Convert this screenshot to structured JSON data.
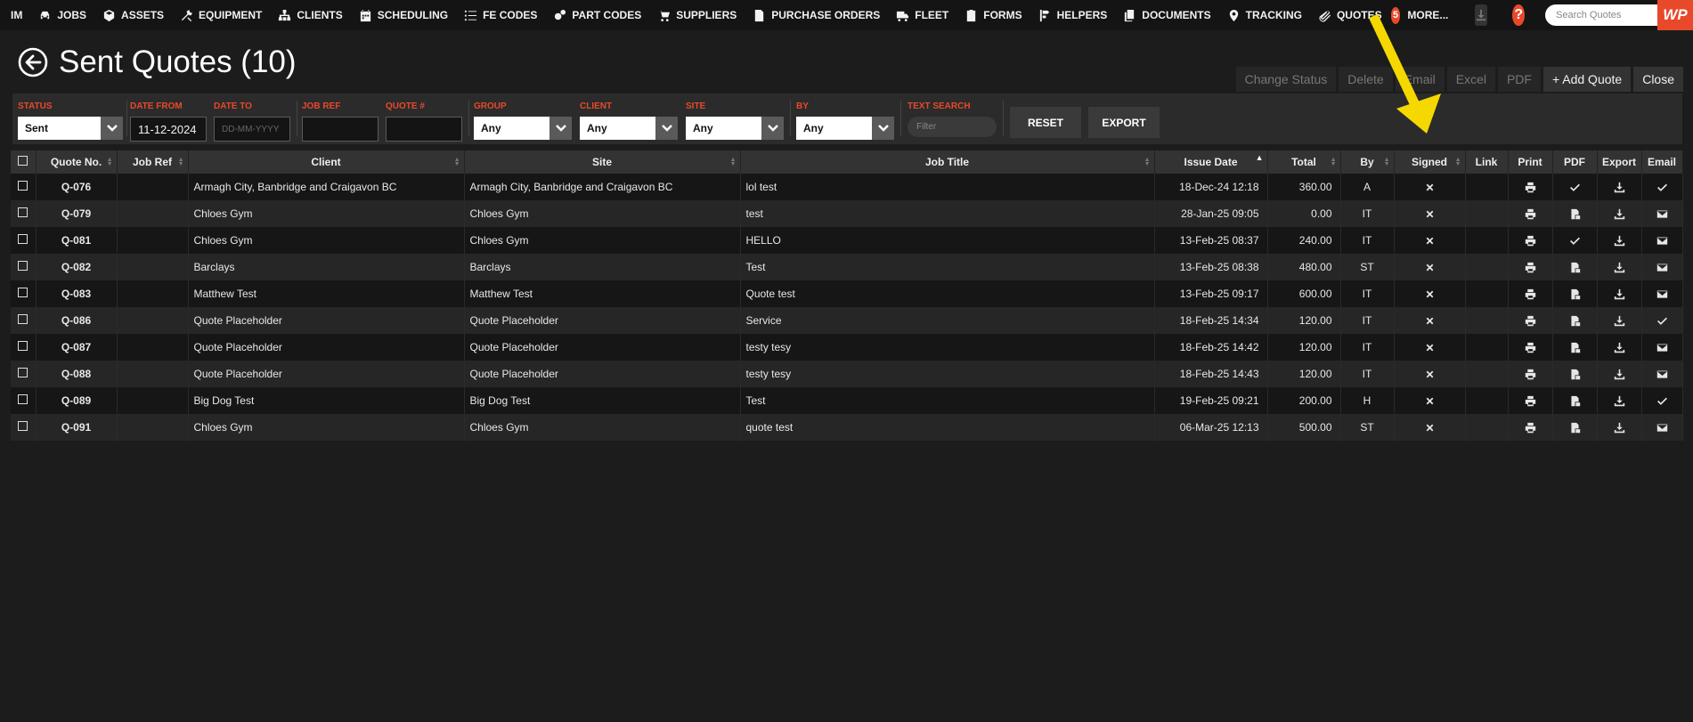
{
  "nav": {
    "items": [
      {
        "label": "IM",
        "icon": ""
      },
      {
        "label": "JOBS",
        "icon": "car-icon"
      },
      {
        "label": "ASSETS",
        "icon": "cube-icon"
      },
      {
        "label": "EQUIPMENT",
        "icon": "tools-icon"
      },
      {
        "label": "CLIENTS",
        "icon": "sitemap-icon"
      },
      {
        "label": "SCHEDULING",
        "icon": "calendar-icon"
      },
      {
        "label": "FE CODES",
        "icon": "list-icon"
      },
      {
        "label": "PART CODES",
        "icon": "gears-icon"
      },
      {
        "label": "SUPPLIERS",
        "icon": "cart-icon"
      },
      {
        "label": "PURCHASE ORDERS",
        "icon": "file-icon"
      },
      {
        "label": "FLEET",
        "icon": "truck-icon"
      },
      {
        "label": "FORMS",
        "icon": "clipboard-icon"
      },
      {
        "label": "HELPERS",
        "icon": "helpers-icon"
      },
      {
        "label": "DOCUMENTS",
        "icon": "documents-icon"
      },
      {
        "label": "TRACKING",
        "icon": "map-pin-icon"
      },
      {
        "label": "QUOTES",
        "icon": "paperclip-icon"
      }
    ],
    "badge_count": "5",
    "more_label": "MORE...",
    "help_label": "?",
    "search_placeholder": "Search Quotes",
    "logo_text": "WP"
  },
  "page": {
    "title": "Sent Quotes (10)"
  },
  "actions": [
    {
      "label": "Change Status",
      "enabled": false
    },
    {
      "label": "Delete",
      "enabled": false
    },
    {
      "label": "Email",
      "enabled": false
    },
    {
      "label": "Excel",
      "enabled": false
    },
    {
      "label": "PDF",
      "enabled": false
    },
    {
      "label": "+ Add Quote",
      "enabled": true
    },
    {
      "label": "Close",
      "enabled": true
    }
  ],
  "filters": {
    "status": {
      "label": "STATUS",
      "value": "Sent"
    },
    "date_from": {
      "label": "DATE FROM",
      "value": "11-12-2024"
    },
    "date_to": {
      "label": "DATE TO",
      "placeholder": "DD-MM-YYYY"
    },
    "job_ref": {
      "label": "JOB REF",
      "value": ""
    },
    "quote_no": {
      "label": "QUOTE #",
      "value": ""
    },
    "group": {
      "label": "GROUP",
      "value": "Any"
    },
    "client": {
      "label": "CLIENT",
      "value": "Any"
    },
    "site": {
      "label": "SITE",
      "value": "Any"
    },
    "by": {
      "label": "BY",
      "value": "Any"
    },
    "text_search": {
      "label": "TEXT SEARCH",
      "placeholder": "Filter"
    },
    "reset_label": "RESET",
    "export_label": "EXPORT"
  },
  "table": {
    "columns": [
      "Quote No.",
      "Job Ref",
      "Client",
      "Site",
      "Job Title",
      "Issue Date",
      "Total",
      "By",
      "Signed",
      "Link",
      "Print",
      "PDF",
      "Export",
      "Email"
    ],
    "rows": [
      {
        "quote_no": "Q-076",
        "job_ref": "",
        "client": "Armagh City, Banbridge and Craigavon BC",
        "site": "Armagh City, Banbridge and Craigavon BC",
        "job_title": "lol test",
        "issue_date": "18-Dec-24 12:18",
        "total": "360.00",
        "by": "A",
        "signed": "cross",
        "pdf": "check",
        "email": "check"
      },
      {
        "quote_no": "Q-079",
        "job_ref": "",
        "client": "Chloes Gym",
        "site": "Chloes Gym",
        "job_title": "test",
        "issue_date": "28-Jan-25 09:05",
        "total": "0.00",
        "by": "IT",
        "signed": "cross",
        "pdf": "pdf",
        "email": "envelope"
      },
      {
        "quote_no": "Q-081",
        "job_ref": "",
        "client": "Chloes Gym",
        "site": "Chloes Gym",
        "job_title": "HELLO",
        "issue_date": "13-Feb-25 08:37",
        "total": "240.00",
        "by": "IT",
        "signed": "cross",
        "pdf": "check",
        "email": "envelope"
      },
      {
        "quote_no": "Q-082",
        "job_ref": "",
        "client": "Barclays",
        "site": "Barclays",
        "job_title": "Test",
        "issue_date": "13-Feb-25 08:38",
        "total": "480.00",
        "by": "ST",
        "signed": "cross",
        "pdf": "pdf",
        "email": "envelope"
      },
      {
        "quote_no": "Q-083",
        "job_ref": "",
        "client": "Matthew Test",
        "site": "Matthew Test",
        "job_title": "Quote test",
        "issue_date": "13-Feb-25 09:17",
        "total": "600.00",
        "by": "IT",
        "signed": "cross",
        "pdf": "pdf",
        "email": "envelope"
      },
      {
        "quote_no": "Q-086",
        "job_ref": "",
        "client": "Quote Placeholder",
        "site": "Quote Placeholder",
        "job_title": "Service",
        "issue_date": "18-Feb-25 14:34",
        "total": "120.00",
        "by": "IT",
        "signed": "cross",
        "pdf": "pdf",
        "email": "check"
      },
      {
        "quote_no": "Q-087",
        "job_ref": "",
        "client": "Quote Placeholder",
        "site": "Quote Placeholder",
        "job_title": "testy tesy",
        "issue_date": "18-Feb-25 14:42",
        "total": "120.00",
        "by": "IT",
        "signed": "cross",
        "pdf": "pdf",
        "email": "envelope"
      },
      {
        "quote_no": "Q-088",
        "job_ref": "",
        "client": "Quote Placeholder",
        "site": "Quote Placeholder",
        "job_title": "testy tesy",
        "issue_date": "18-Feb-25 14:43",
        "total": "120.00",
        "by": "IT",
        "signed": "cross",
        "pdf": "pdf",
        "email": "envelope"
      },
      {
        "quote_no": "Q-089",
        "job_ref": "",
        "client": "Big Dog Test",
        "site": "Big Dog Test",
        "job_title": "Test",
        "issue_date": "19-Feb-25 09:21",
        "total": "200.00",
        "by": "H",
        "signed": "cross",
        "pdf": "pdf",
        "email": "check"
      },
      {
        "quote_no": "Q-091",
        "job_ref": "",
        "client": "Chloes Gym",
        "site": "Chloes Gym",
        "job_title": "quote test",
        "issue_date": "06-Mar-25 12:13",
        "total": "500.00",
        "by": "ST",
        "signed": "cross",
        "pdf": "pdf",
        "email": "envelope"
      }
    ]
  },
  "colors": {
    "accent": "#e8492b",
    "annotation_arrow": "#f5d800"
  }
}
